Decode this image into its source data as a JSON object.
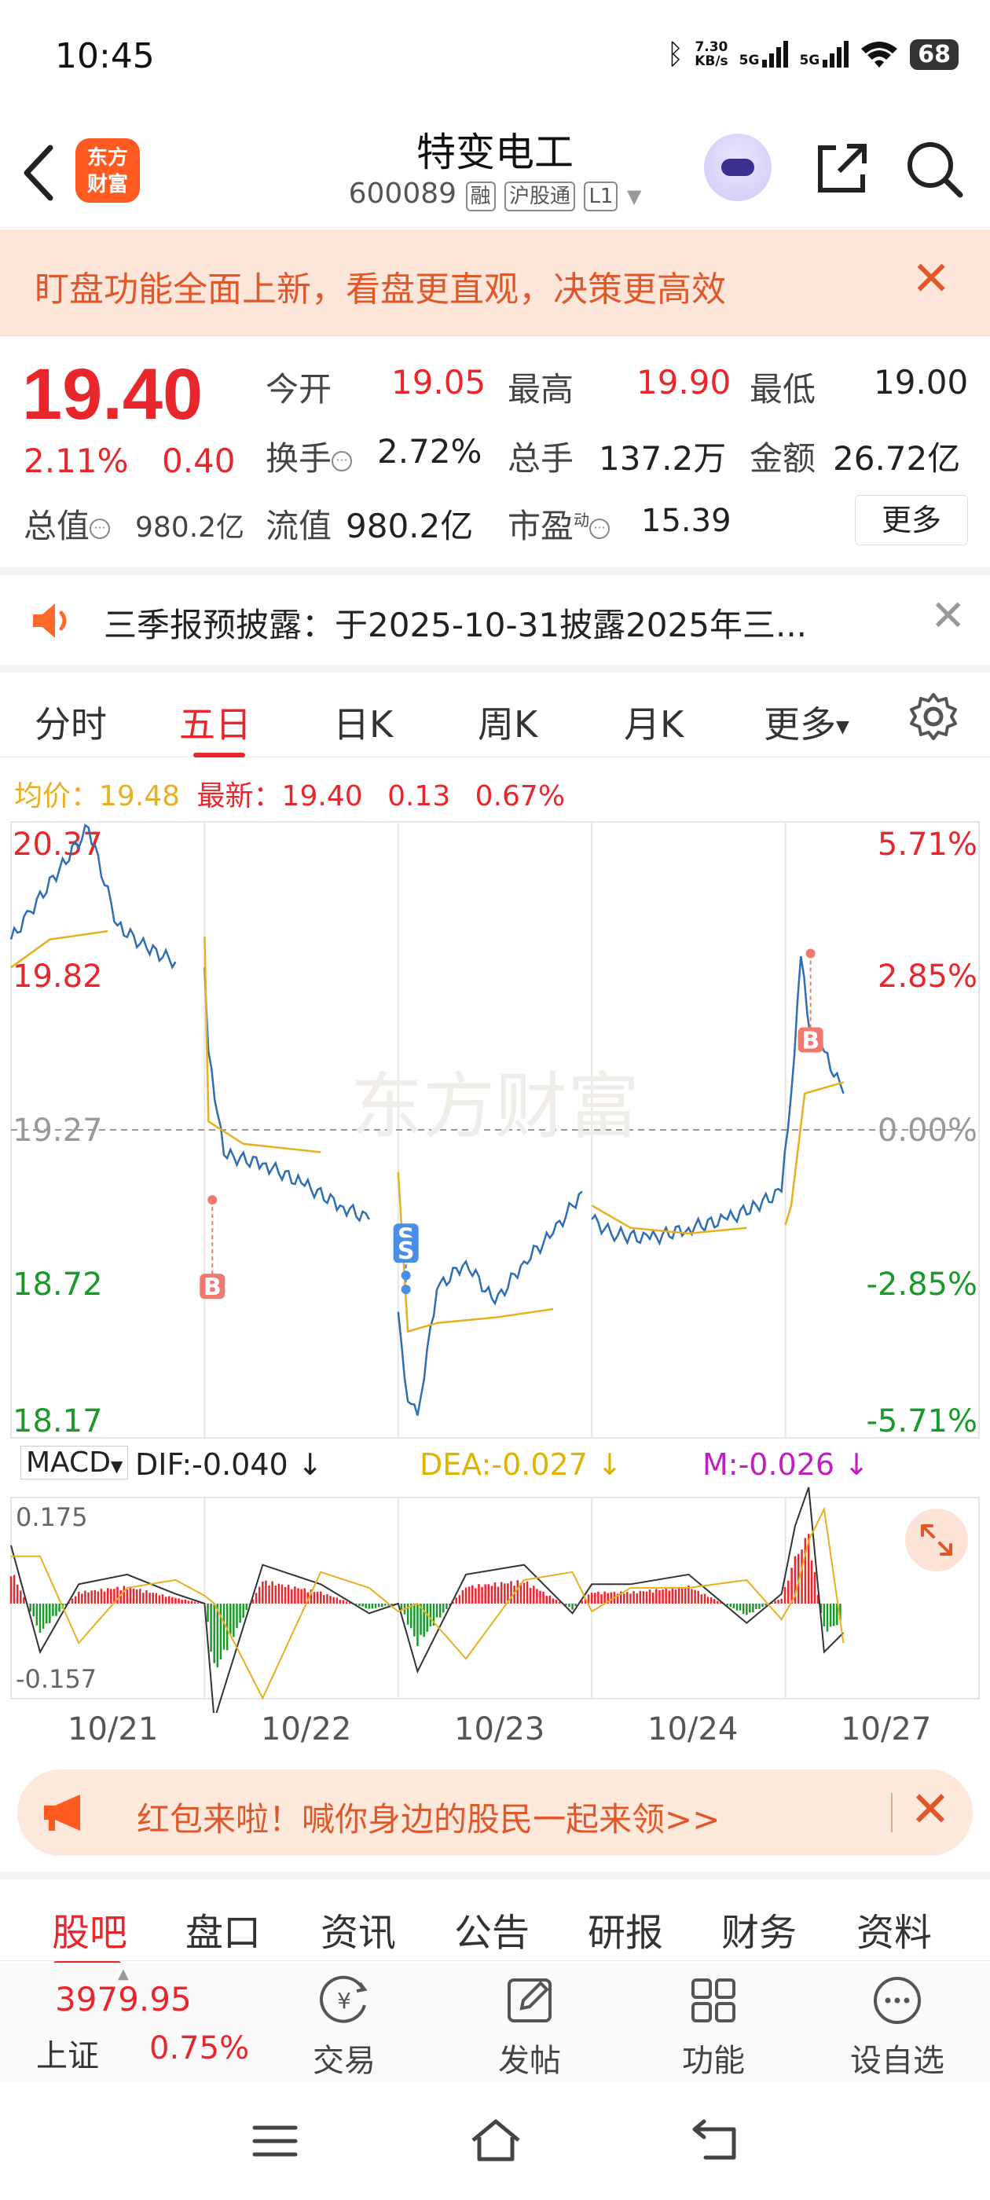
{
  "status_bar": {
    "time": "10:45",
    "net_speed_top": "7.30",
    "net_speed_bottom": "KB/s",
    "sim1": "5G",
    "sim2": "5G",
    "battery": "68"
  },
  "header": {
    "logo_line1": "东方",
    "logo_line2": "财富",
    "stock_name": "特变电工",
    "stock_code": "600089",
    "tag_margin": "融",
    "tag_connect": "沪股通",
    "tag_level": "L1"
  },
  "notice_banner": {
    "text": "盯盘功能全面上新，看盘更直观，决策更高效"
  },
  "quote": {
    "price": "19.40",
    "change_pct": "2.11%",
    "change_abs": "0.40",
    "open_label": "今开",
    "open_value": "19.05",
    "high_label": "最高",
    "high_value": "19.90",
    "low_label": "最低",
    "low_value": "19.00",
    "turnover_label": "换手",
    "turnover_value": "2.72%",
    "volume_label": "总手",
    "volume_value": "137.2万",
    "amount_label": "金额",
    "amount_value": "26.72亿",
    "mktcap_label": "总值",
    "mktcap_value": "980.2亿",
    "float_label": "流值",
    "float_value": "980.2亿",
    "pe_label": "市盈",
    "pe_sup": "动",
    "pe_value": "15.39",
    "more_label": "更多"
  },
  "report_notice": {
    "text": "三季报预披露：于2025-10-31披露2025年三..."
  },
  "chart_tabs": {
    "items": [
      "分时",
      "五日",
      "日K",
      "周K",
      "月K"
    ],
    "more": "更多",
    "active_index": 1
  },
  "chart_info": {
    "avg_label": "均价：",
    "avg_value": "19.48",
    "latest_label": "最新：",
    "latest_value": "19.40",
    "latest_change": "0.13",
    "latest_pct": "0.67%",
    "watermark": "东方财富"
  },
  "chart_data": [
    {
      "type": "line",
      "title": "五日分时",
      "x_labels": [
        "10/21",
        "10/22",
        "10/23",
        "10/24",
        "10/27"
      ],
      "y_ticks_price": [
        "20.37",
        "19.82",
        "19.27",
        "18.72",
        "18.17"
      ],
      "y_ticks_pct": [
        "5.71%",
        "2.85%",
        "0.00%",
        "-2.85%",
        "-5.71%"
      ],
      "ylim": [
        18.17,
        20.37
      ],
      "prev_close": 19.27,
      "series": [
        {
          "name": "价格",
          "color": "#2f6db5",
          "x": [
            0,
            0.1,
            0.25,
            0.4,
            0.55,
            0.7,
            0.85,
            1.0,
            1.02,
            1.1,
            1.3,
            1.5,
            1.7,
            1.85,
            2.0,
            2.05,
            2.1,
            2.2,
            2.35,
            2.5,
            2.65,
            2.8,
            2.95,
            3.0,
            3.1,
            3.3,
            3.5,
            3.7,
            3.85,
            3.98,
            4.03,
            4.08,
            4.13,
            4.2,
            4.3
          ],
          "values": [
            19.95,
            20.05,
            20.2,
            20.35,
            20.0,
            19.92,
            19.87,
            19.85,
            19.55,
            19.18,
            19.15,
            19.08,
            19.0,
            18.95,
            18.62,
            18.3,
            18.25,
            18.7,
            18.8,
            18.65,
            18.8,
            18.9,
            19.05,
            18.95,
            18.9,
            18.88,
            18.92,
            18.95,
            19.0,
            19.05,
            19.4,
            19.89,
            19.6,
            19.55,
            19.4
          ]
        },
        {
          "name": "均价",
          "color": "#e8b020",
          "x": [
            0,
            0.2,
            0.5,
            1.0,
            1.02,
            1.2,
            1.6,
            2.0,
            2.05,
            2.2,
            2.5,
            2.8,
            3.0,
            3.2,
            3.5,
            3.8,
            4.0,
            4.03,
            4.1,
            4.3
          ],
          "values": [
            19.85,
            19.95,
            19.98,
            19.96,
            19.3,
            19.22,
            19.19,
            19.12,
            18.55,
            18.58,
            18.6,
            18.63,
            19.0,
            18.92,
            18.9,
            18.92,
            18.93,
            19.0,
            19.4,
            19.44
          ]
        }
      ],
      "markers": [
        {
          "label": "B",
          "x": 1.04,
          "value": 19.02
        },
        {
          "label": "S",
          "x": 2.04,
          "value": 18.75
        },
        {
          "label": "S",
          "x": 2.04,
          "value": 18.7
        },
        {
          "label": "B",
          "x": 4.13,
          "value": 19.9
        }
      ]
    },
    {
      "type": "bar",
      "title": "MACD",
      "ylim": [
        -0.157,
        0.175
      ],
      "y_ticks": [
        "0.175",
        "-0.157"
      ],
      "x": [
        0,
        0.15,
        0.35,
        0.6,
        0.85,
        1.0,
        1.05,
        1.3,
        1.6,
        1.85,
        2.0,
        2.1,
        2.35,
        2.65,
        2.9,
        3.0,
        3.2,
        3.5,
        3.8,
        3.98,
        4.05,
        4.12,
        4.2,
        4.3
      ],
      "values": [
        0.06,
        -0.05,
        0.02,
        0.03,
        0.01,
        0.0,
        -0.12,
        0.04,
        0.02,
        -0.01,
        0.0,
        -0.07,
        0.03,
        0.04,
        -0.01,
        0.02,
        0.02,
        0.03,
        -0.02,
        0.01,
        0.08,
        0.12,
        -0.05,
        -0.03
      ],
      "series": [
        {
          "name": "DIF",
          "value_text": "-0.040"
        },
        {
          "name": "DEA",
          "value_text": "-0.027"
        },
        {
          "name": "M",
          "value_text": "-0.026"
        }
      ]
    }
  ],
  "macd": {
    "select_label": "MACD",
    "dif": "DIF:-0.040 ↓",
    "dea": "DEA:-0.027 ↓",
    "m": "M:-0.026 ↓"
  },
  "red_packet": {
    "text": "红包来啦！喊你身边的股民一起来领>>"
  },
  "bottom_tabs": [
    "股吧",
    "盘口",
    "资讯",
    "公告",
    "研报",
    "财务",
    "资料"
  ],
  "footer": {
    "index_value": "3979.95",
    "index_name": "上证",
    "index_pct": "0.75%",
    "trade": "交易",
    "post": "发帖",
    "functions": "功能",
    "watchlist": "设自选"
  }
}
